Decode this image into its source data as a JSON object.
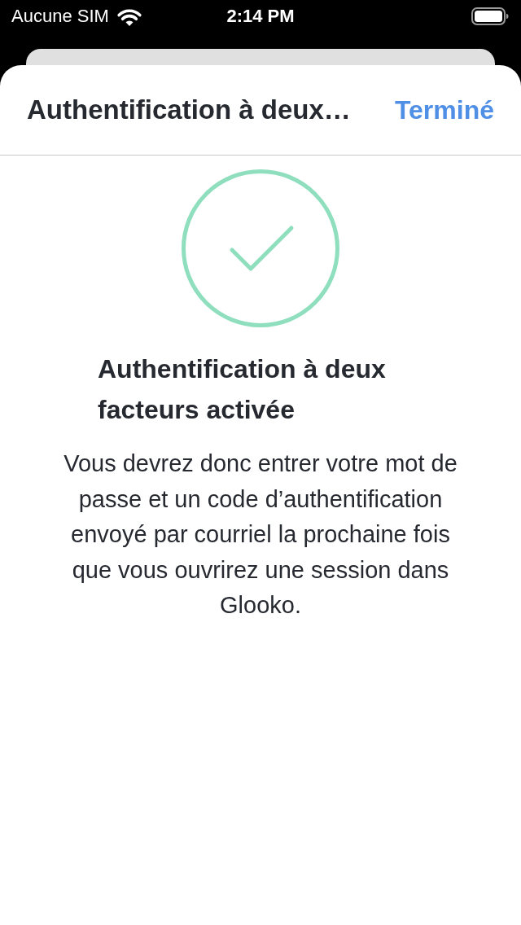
{
  "status_bar": {
    "carrier": "Aucune SIM",
    "time": "2:14 PM"
  },
  "header": {
    "title": "Authentification à deux…",
    "done_button": "Terminé"
  },
  "confirmation": {
    "heading": "Authentification à deux facteurs activée",
    "message": "Vous devrez donc entrer votre mot de passe et un code d’authentification envoyé par courriel la prochaine fois que vous ouvrirez une session dans Glooko."
  }
}
